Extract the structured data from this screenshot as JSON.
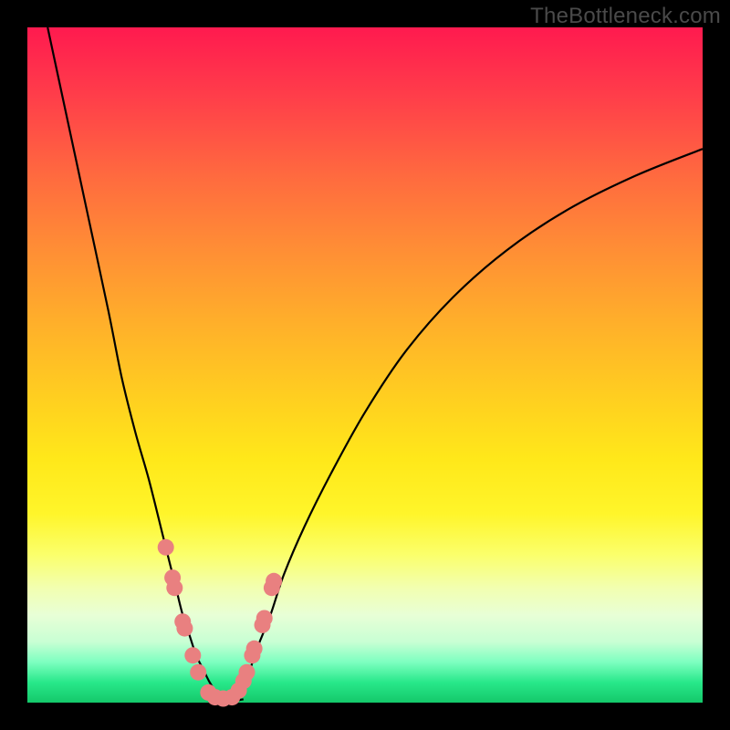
{
  "attribution": "TheBottleneck.com",
  "colors": {
    "dot": "#e98080",
    "curve": "#000000",
    "frame": "#000000"
  },
  "chart_data": {
    "type": "line",
    "title": "",
    "xlabel": "",
    "ylabel": "",
    "xlim": [
      0,
      100
    ],
    "ylim": [
      0,
      100
    ],
    "grid": false,
    "legend": false,
    "annotations": [
      "TheBottleneck.com"
    ],
    "series": [
      {
        "name": "left-branch",
        "x": [
          3,
          6,
          9,
          12,
          14,
          16,
          18,
          20,
          21,
          22,
          23,
          24,
          25,
          26,
          27,
          28,
          29
        ],
        "y": [
          100,
          86,
          72,
          58,
          48,
          40,
          33,
          25,
          21,
          17,
          13,
          10,
          7,
          5,
          3,
          1.5,
          0.5
        ]
      },
      {
        "name": "right-branch",
        "x": [
          30,
          31,
          32,
          33,
          34,
          36,
          38,
          41,
          45,
          50,
          56,
          63,
          71,
          80,
          90,
          100
        ],
        "y": [
          0.5,
          1.5,
          3,
          5,
          8,
          13,
          19,
          26,
          34,
          43,
          52,
          60,
          67,
          73,
          78,
          82
        ]
      },
      {
        "name": "valley-floor",
        "x": [
          27,
          28,
          29,
          30,
          31,
          32
        ],
        "y": [
          0.5,
          0.3,
          0.2,
          0.2,
          0.3,
          0.5
        ]
      }
    ],
    "markers": {
      "name": "highlight-dots",
      "x": [
        20.5,
        21.5,
        21.8,
        23.0,
        23.3,
        24.5,
        25.3,
        26.8,
        27.8,
        29.0,
        30.3,
        31.3,
        32.0,
        32.5,
        33.3,
        33.6,
        34.8,
        35.1,
        36.2,
        36.5
      ],
      "y": [
        23.0,
        18.5,
        17.0,
        12.0,
        11.0,
        7.0,
        4.5,
        1.5,
        0.8,
        0.6,
        0.8,
        1.8,
        3.2,
        4.5,
        7.0,
        8.0,
        11.5,
        12.5,
        17.0,
        18.0
      ]
    }
  }
}
